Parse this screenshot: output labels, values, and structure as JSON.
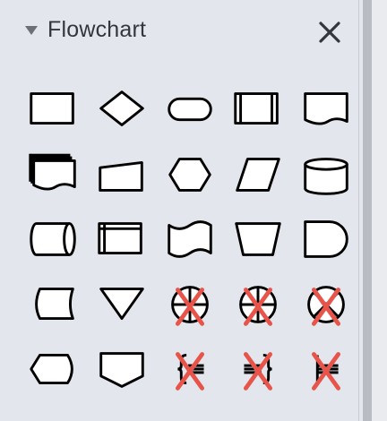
{
  "panel": {
    "title": "Flowchart",
    "collapse_icon": "triangle-down-icon",
    "close_icon": "close-icon"
  },
  "colors": {
    "background": "#e3e6ec",
    "stroke": "#000000",
    "fill": "#ffffff",
    "unavailable_mark": "#e8544a"
  },
  "shapes": [
    {
      "name": "process-shape"
    },
    {
      "name": "decision-shape"
    },
    {
      "name": "terminator-shape"
    },
    {
      "name": "predefined-process-shape"
    },
    {
      "name": "document-shape"
    },
    {
      "name": "multi-document-shape"
    },
    {
      "name": "manual-input-shape"
    },
    {
      "name": "preparation-shape"
    },
    {
      "name": "data-shape"
    },
    {
      "name": "database-shape"
    },
    {
      "name": "direct-data-shape"
    },
    {
      "name": "internal-storage-shape"
    },
    {
      "name": "paper-tape-shape"
    },
    {
      "name": "manual-operation-shape"
    },
    {
      "name": "delay-shape"
    },
    {
      "name": "stored-data-shape"
    },
    {
      "name": "merge-shape"
    },
    {
      "name": "or-shape",
      "unavailable": true
    },
    {
      "name": "summing-junction-shape",
      "unavailable": true
    },
    {
      "name": "collate-shape",
      "unavailable": true
    },
    {
      "name": "display-shape"
    },
    {
      "name": "off-page-connector-shape"
    },
    {
      "name": "annotation-left-shape",
      "unavailable": true
    },
    {
      "name": "annotation-right-shape",
      "unavailable": true
    },
    {
      "name": "annotation-bracket-shape",
      "unavailable": true
    }
  ]
}
